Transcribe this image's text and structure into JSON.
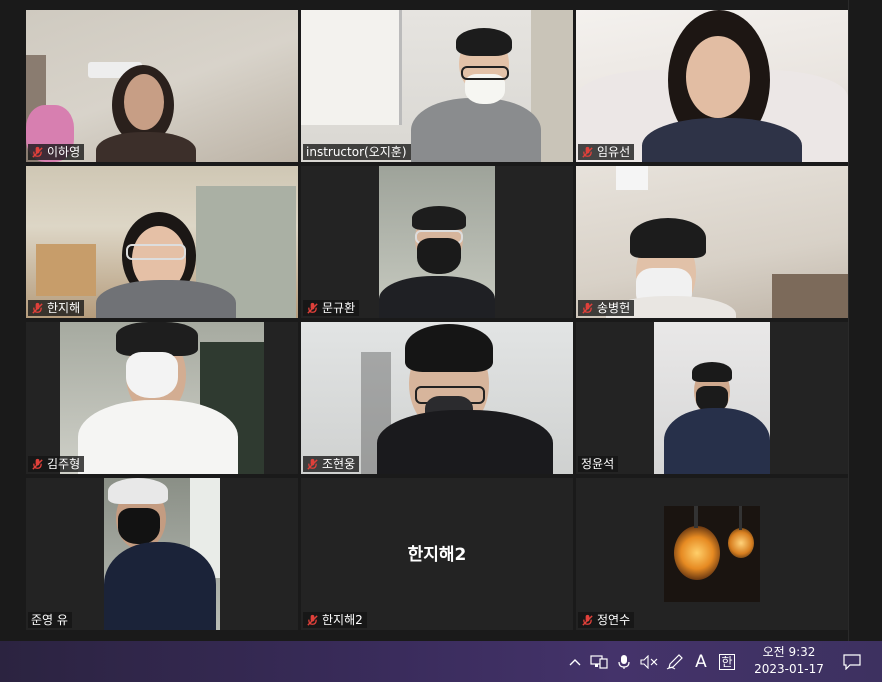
{
  "participants": [
    {
      "name": "이하영",
      "muted": true
    },
    {
      "name": "instructor(오지훈)",
      "muted": false
    },
    {
      "name": "임유선",
      "muted": true
    },
    {
      "name": "한지해",
      "muted": true,
      "active_speaker": true
    },
    {
      "name": "문규환",
      "muted": true
    },
    {
      "name": "송병헌",
      "muted": true
    },
    {
      "name": "김주형",
      "muted": true
    },
    {
      "name": "조현웅",
      "muted": true
    },
    {
      "name": "정윤석",
      "muted": false
    },
    {
      "name": "준영 유",
      "muted": false
    },
    {
      "name": "한지해2",
      "muted": true,
      "video_off": true,
      "display_name": "한지해2"
    },
    {
      "name": "정연수",
      "muted": true
    }
  ],
  "taskbar": {
    "tray_icons": [
      "chevron-up-icon",
      "network-icon",
      "microphone-icon",
      "speaker-muted-icon",
      "pen-icon",
      "font-icon",
      "ime-icon"
    ],
    "font_label": "A",
    "ime_label": "한",
    "time": "오전 9:32",
    "date": "2023-01-17"
  },
  "colors": {
    "active_speaker_border": "#c8d34a",
    "mute_icon": "#e0403a",
    "taskbar": "#3a2c5c"
  }
}
